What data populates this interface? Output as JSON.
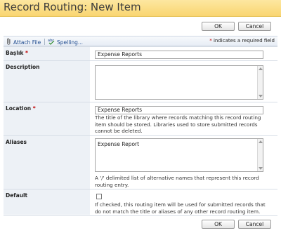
{
  "window": {
    "title": "Record Routing: New Item"
  },
  "actions": {
    "ok_label": "OK",
    "cancel_label": "Cancel"
  },
  "toolbar": {
    "attach_label": "Attach File",
    "spelling_label": "Spelling...",
    "required_star": "*",
    "required_note": "indicates a required field",
    "attach_icon": "paperclip-icon",
    "spelling_icon": "spellcheck-icon"
  },
  "fields": {
    "title": {
      "label": "Başlık",
      "required_star": "*",
      "value": "Expense Reports"
    },
    "description": {
      "label": "Description",
      "value": ""
    },
    "location": {
      "label": "Location",
      "required_star": "*",
      "value": "Expense Reports",
      "help": "The title of the library where records matching this record routing item should be stored. Libraries used to store submitted records cannot be deleted."
    },
    "aliases": {
      "label": "Aliases",
      "value": "Expense Report",
      "help": "A '/' delimited list of alternative names that represent this record routing entry."
    },
    "default": {
      "label": "Default",
      "checked": false,
      "help": "If checked, this routing item will be used for submitted records that do not match the title or aliases of any other record routing item."
    }
  },
  "colors": {
    "title_bar": "#f9d571",
    "required": "#c00000",
    "label_bg": "#edf1f6",
    "link": "#1f4b8f"
  }
}
